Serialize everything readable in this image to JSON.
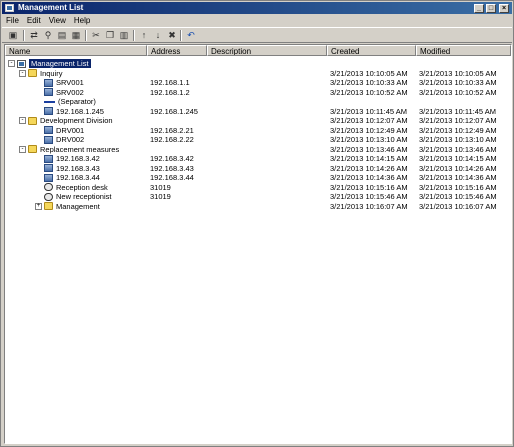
{
  "window": {
    "title": "Management List",
    "min": "_",
    "max": "□",
    "close": "×"
  },
  "menu": [
    "File",
    "Edit",
    "View",
    "Help"
  ],
  "columns": {
    "name": "Name",
    "address": "Address",
    "description": "Description",
    "created": "Created",
    "modified": "Modified"
  },
  "rows": [
    {
      "level": 0,
      "icon": "root-icon",
      "name": "Management List",
      "address": "",
      "created": "",
      "modified": "",
      "expander": "-",
      "selected": true
    },
    {
      "level": 1,
      "icon": "folder-icon",
      "name": "Inquiry",
      "address": "",
      "created": "3/21/2013 10:10:05 AM",
      "modified": "3/21/2013 10:10:05 AM",
      "expander": "-"
    },
    {
      "level": 2,
      "icon": "server-icon",
      "name": "SRV001",
      "address": "192.168.1.1",
      "created": "3/21/2013 10:10:33 AM",
      "modified": "3/21/2013 10:10:33 AM"
    },
    {
      "level": 2,
      "icon": "server-icon",
      "name": "SRV002",
      "address": "192.168.1.2",
      "created": "3/21/2013 10:10:52 AM",
      "modified": "3/21/2013 10:10:52 AM"
    },
    {
      "level": 2,
      "icon": "separator-icon",
      "name": "(Separator)",
      "address": "",
      "created": "",
      "modified": ""
    },
    {
      "level": 2,
      "icon": "computer-icon",
      "name": "192.168.1.245",
      "address": "192.168.1.245",
      "created": "3/21/2013 10:11:45 AM",
      "modified": "3/21/2013 10:11:45 AM"
    },
    {
      "level": 1,
      "icon": "folder-icon",
      "name": "Development Division",
      "address": "",
      "created": "3/21/2013 10:12:07 AM",
      "modified": "3/21/2013 10:12:07 AM",
      "expander": "-"
    },
    {
      "level": 2,
      "icon": "server-icon",
      "name": "DRV001",
      "address": "192.168.2.21",
      "created": "3/21/2013 10:12:49 AM",
      "modified": "3/21/2013 10:12:49 AM"
    },
    {
      "level": 2,
      "icon": "server-icon",
      "name": "DRV002",
      "address": "192.168.2.22",
      "created": "3/21/2013 10:13:10 AM",
      "modified": "3/21/2013 10:13:10 AM"
    },
    {
      "level": 1,
      "icon": "folder-icon",
      "name": "Replacement measures",
      "address": "",
      "created": "3/21/2013 10:13:46 AM",
      "modified": "3/21/2013 10:13:46 AM",
      "expander": "-"
    },
    {
      "level": 2,
      "icon": "computer-icon",
      "name": "192.168.3.42",
      "address": "192.168.3.42",
      "created": "3/21/2013 10:14:15 AM",
      "modified": "3/21/2013 10:14:15 AM"
    },
    {
      "level": 2,
      "icon": "computer-icon",
      "name": "192.168.3.43",
      "address": "192.168.3.43",
      "created": "3/21/2013 10:14:26 AM",
      "modified": "3/21/2013 10:14:26 AM"
    },
    {
      "level": 2,
      "icon": "computer-icon",
      "name": "192.168.3.44",
      "address": "192.168.3.44",
      "created": "3/21/2013 10:14:36 AM",
      "modified": "3/21/2013 10:14:36 AM"
    },
    {
      "level": 2,
      "icon": "phone-icon",
      "name": "Reception desk",
      "address": "31019",
      "created": "3/21/2013 10:15:16 AM",
      "modified": "3/21/2013 10:15:16 AM"
    },
    {
      "level": 2,
      "icon": "phone-icon",
      "name": "New receptionist",
      "address": "31019",
      "created": "3/21/2013 10:15:46 AM",
      "modified": "3/21/2013 10:15:46 AM"
    },
    {
      "level": 2,
      "icon": "folder-icon",
      "name": "Management",
      "address": "",
      "created": "3/21/2013 10:16:07 AM",
      "modified": "3/21/2013 10:16:07 AM",
      "expander": "+"
    }
  ],
  "colors": {
    "titlebar": "#0a246a",
    "selection": "#0a246a",
    "folder": "#f5d75a"
  }
}
